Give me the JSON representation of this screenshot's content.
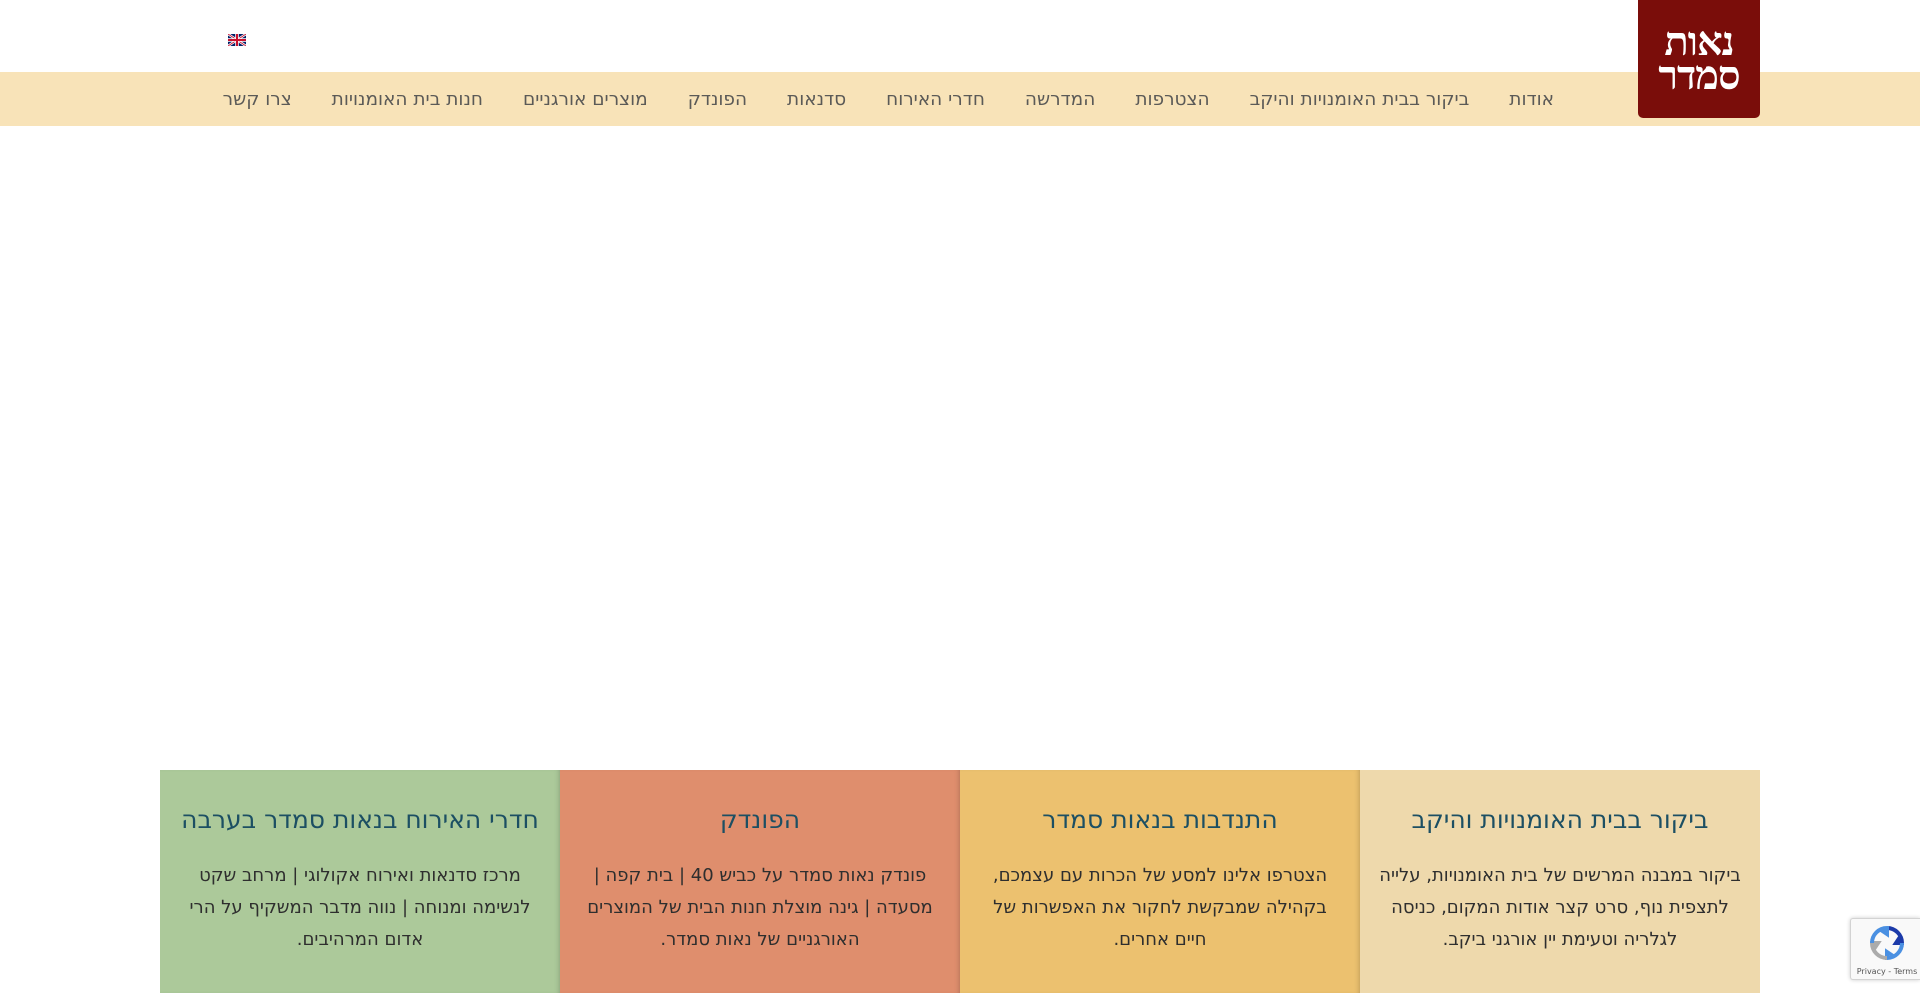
{
  "header": {
    "logo_text": "נאות\nסמדר",
    "language_flag": "uk-flag-icon"
  },
  "nav": {
    "items": [
      {
        "label": "אודות"
      },
      {
        "label": "ביקור בבית האומנויות והיקב"
      },
      {
        "label": "הצטרפות"
      },
      {
        "label": "המדרשה"
      },
      {
        "label": "חדרי האירוח"
      },
      {
        "label": "סדנאות"
      },
      {
        "label": "הפונדק"
      },
      {
        "label": "מוצרים אורגניים"
      },
      {
        "label": "חנות בית האומנויות"
      },
      {
        "label": "צרו קשר"
      }
    ]
  },
  "cards": [
    {
      "title": "ביקור בבית האומנויות והיקב",
      "text": "ביקור במבנה המרשים של בית האומנויות, עלייה לתצפית נוף, סרט קצר אודות המקום, כניסה לגלריה וטעימת יין אורגני ביקב.",
      "color": "#eed9ac"
    },
    {
      "title": "התנדבות בנאות סמדר",
      "text": "הצטרפו אלינו למסע של הכרות עם עצמכם, בקהילה שמבקשת לחקור את האפשרות של חיים אחרים.",
      "color": "#ecc16f"
    },
    {
      "title": "הפונדק",
      "text": "פונדק נאות סמדר על כביש 40 | בית קפה | מסעדה | גינה מוצלת חנות הבית של המוצרים האורגניים של נאות סמדר.",
      "color": "#df8e6d"
    },
    {
      "title": "חדרי האירוח בנאות סמדר בערבה",
      "text": "מרכז סדנאות ואירוח אקולוגי | מרחב שקט לנשימה ומנוחה | נווה מדבר המשקיף על הרי אדום המרהיבים.",
      "color": "#acc99a"
    }
  ],
  "recaptcha": {
    "links": "Privacy - Terms"
  }
}
